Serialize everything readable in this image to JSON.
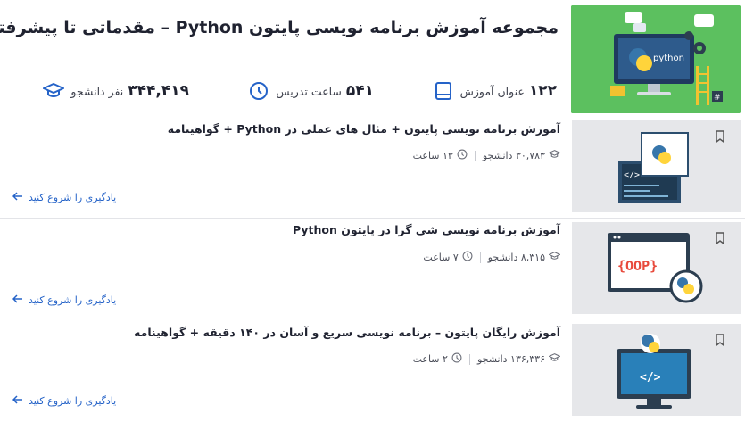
{
  "header": {
    "title": "مجموعه آموزش برنامه نویسی پایتون Python – مقدماتی تا پیشرفته",
    "banner_word": "python",
    "stats": {
      "courses": {
        "value": "۱۲۲",
        "label": "عنوان آموزش",
        "icon": "book-icon"
      },
      "hours": {
        "value": "۵۴۱",
        "label": "ساعت تدریس",
        "icon": "clock-icon"
      },
      "students": {
        "value": "۳۴۴,۴۱۹",
        "label": "نفر دانشجو",
        "icon": "graduation-cap-icon"
      }
    }
  },
  "courses": [
    {
      "title": "آموزش برنامه نویسی پایتون + مثال های عملی در Python + گواهینامه",
      "students": "۳۰,۷۸۳ دانشجو",
      "hours": "۱۳ ساعت",
      "cta": "یادگیری را شروع کنید"
    },
    {
      "title": "آموزش برنامه نویسی شی گرا در پایتون Python",
      "students": "۸,۳۱۵ دانشجو",
      "hours": "۷ ساعت",
      "cta": "یادگیری را شروع کنید",
      "thumb_text": "{OOP}"
    },
    {
      "title": "آموزش رایگان پایتون – برنامه نویسی سریع و آسان در ۱۴۰ دقیقه + گواهینامه",
      "students": "۱۳۶,۳۳۶ دانشجو",
      "hours": "۲ ساعت",
      "cta": "یادگیری را شروع کنید",
      "thumb_text": "</>"
    }
  ],
  "colors": {
    "hero_bg": "#5cc05f",
    "accent_blue": "#2563c8",
    "thumb_bg": "#e6e7ea",
    "icon_bg": "#2c3e50"
  }
}
